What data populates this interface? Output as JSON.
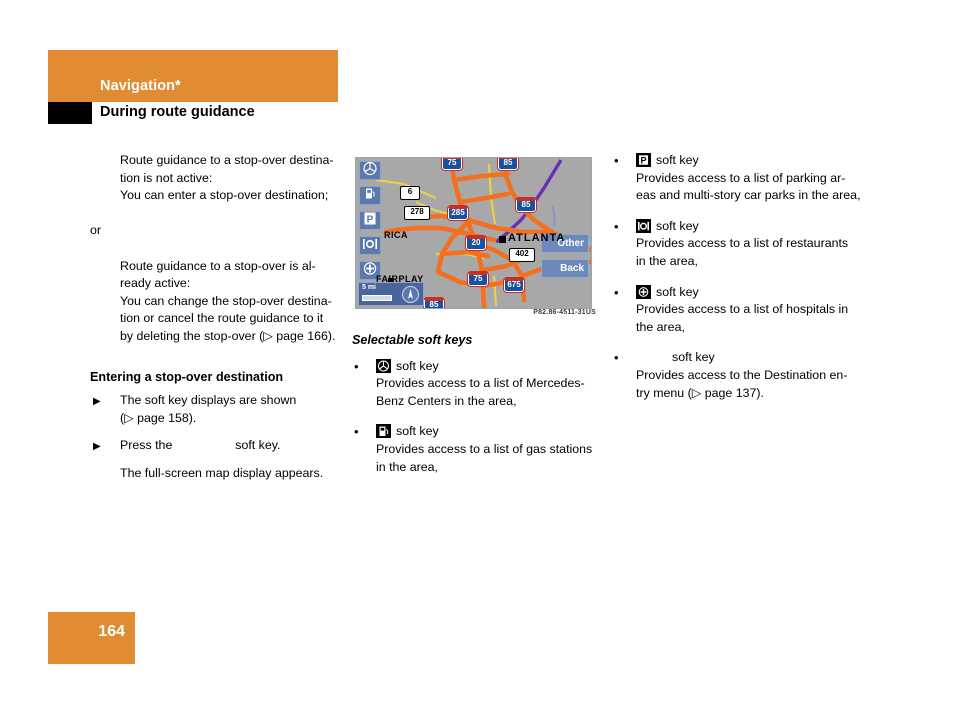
{
  "header": {
    "chapter": "Navigation*",
    "section": "During route guidance",
    "band_color": "#e18b33"
  },
  "left_column": {
    "p1_line1": "Route guidance to a stop-over destina-",
    "p1_line2": "tion is not active:",
    "p2": "You can enter a stop-over destination;",
    "or": "or",
    "p3_line1": "Route guidance to a stop-over is al-",
    "p3_line2": "ready active:",
    "p4_line1": "You can change the stop-over destina-",
    "p4_line2": "tion or cancel the route guidance to it",
    "p4_line3": "by deleting the stop-over (▷ page 166).",
    "subheading": "Entering a stop-over destination",
    "step1_line1": "The soft key displays are shown",
    "step1_line2": "(▷ page 158).",
    "step2_prefix": "Press the",
    "step2_suffix": "soft key.",
    "step2_result": "The full-screen map display appears."
  },
  "map": {
    "caption": "P82.86-4511-31US",
    "city": "ATLANTA",
    "town1": "RICA",
    "town2": "FAIRPLAY",
    "scale": "5 mi",
    "softkey_other": "Other",
    "softkey_back": "Back",
    "shields": [
      {
        "label": "75",
        "type": "interstate"
      },
      {
        "label": "85",
        "type": "interstate"
      },
      {
        "label": "285",
        "type": "interstate"
      },
      {
        "label": "20",
        "type": "interstate"
      },
      {
        "label": "675",
        "type": "interstate"
      },
      {
        "label": "6",
        "type": "us"
      },
      {
        "label": "278",
        "type": "us"
      },
      {
        "label": "402",
        "type": "us"
      }
    ],
    "left_keys": [
      "mercedes-star",
      "gas-pump",
      "parking-p",
      "restaurant",
      "hospital-cross"
    ]
  },
  "mid_column": {
    "heading": "Selectable soft keys",
    "items": [
      {
        "icon": "mercedes-star",
        "head_suffix": "soft key",
        "body_line1": "Provides access to a list of Mercedes-",
        "body_line2": "Benz Centers in the area,"
      },
      {
        "icon": "gas-pump",
        "head_suffix": "soft key",
        "body_line1": "Provides access to a list of gas stations",
        "body_line2": "in the area,"
      }
    ]
  },
  "right_column": {
    "items": [
      {
        "icon": "parking-p",
        "head_suffix": "soft key",
        "body_line1": "Provides access to a list of parking ar-",
        "body_line2": "eas and multi-story car parks in the area,"
      },
      {
        "icon": "restaurant",
        "head_suffix": "soft key",
        "body_line1": "Provides access to a list of restaurants",
        "body_line2": "in the area,"
      },
      {
        "icon": "hospital-cross",
        "head_suffix": "soft key",
        "body_line1": "Provides access to a list of hospitals in",
        "body_line2": "the area,"
      },
      {
        "icon": "missing",
        "head_suffix": "soft key",
        "body_line1": "Provides access to the Destination en-",
        "body_line2": "try menu (▷ page 137)."
      }
    ]
  },
  "footer": {
    "page_number": "164"
  }
}
